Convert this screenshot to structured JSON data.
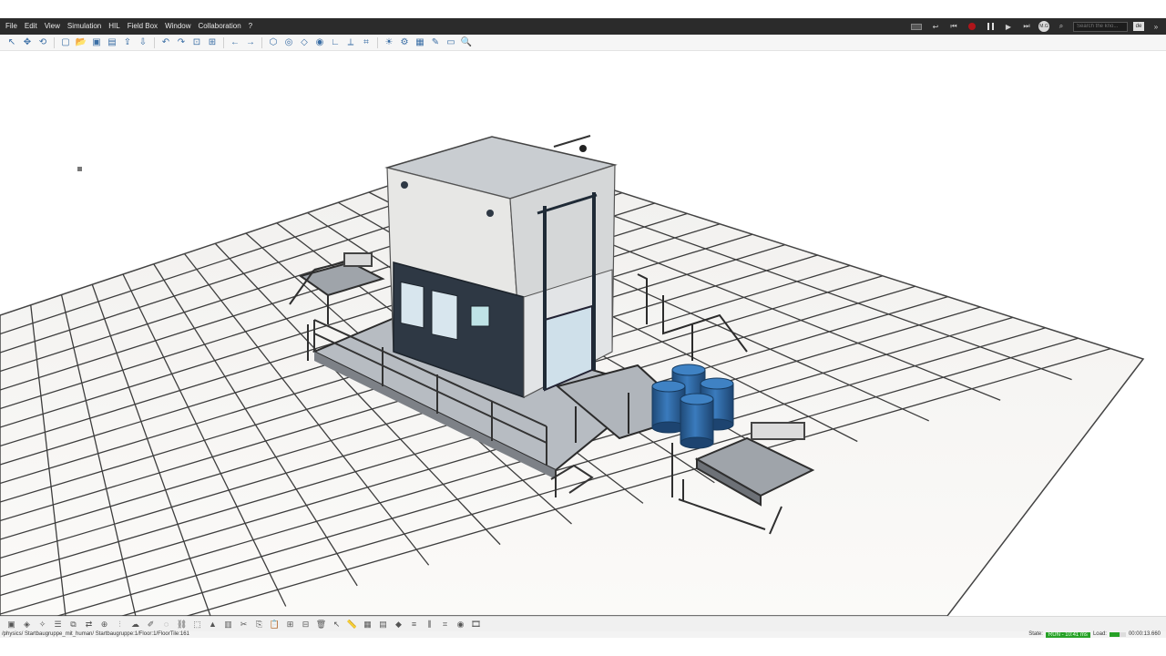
{
  "menubar": {
    "items": [
      "File",
      "Edit",
      "View",
      "Simulation",
      "HIL",
      "Field Box",
      "Window",
      "Collaboration",
      "?"
    ],
    "search_placeholder": "Search the kno...",
    "avatar_initials": "M.G",
    "lang": "de"
  },
  "toolbar": {
    "icons": [
      "select-arrow-icon",
      "move-icon",
      "rotate-icon",
      "new-file-icon",
      "open-folder-icon",
      "save-icon",
      "save-all-icon",
      "export-icon",
      "import-icon",
      "undo-icon",
      "redo-icon",
      "zoom-fit-icon",
      "zoom-select-icon",
      "arrow-left-icon",
      "arrow-right-icon",
      "cube-view-icon",
      "orbit-icon",
      "box-icon",
      "camera-icon",
      "axes-icon",
      "measure-icon",
      "snap-icon",
      "light-icon",
      "gear-icon",
      "grid-icon",
      "brush-icon",
      "window-icon",
      "search-zoom-icon"
    ]
  },
  "viewport": {
    "description_hidden": ""
  },
  "bottom_toolbar": {
    "icons": [
      "frame-icon",
      "component-icon",
      "wrench-icon",
      "list-icon",
      "merge-icon",
      "connect-icon",
      "add-node-icon",
      "split-icon",
      "cloud-icon",
      "pen-icon",
      "lasso-icon",
      "link-icon",
      "box-select-icon",
      "paint-icon",
      "layers-icon",
      "cut-icon",
      "copy-icon",
      "paste-icon",
      "group-icon",
      "ungroup-icon",
      "trash-icon",
      "cursor-icon",
      "ruler-icon",
      "table-icon",
      "chart-icon",
      "shape-icon",
      "align-icon",
      "distribute-icon",
      "snap-grid-icon",
      "camera-icon",
      "film-icon"
    ]
  },
  "statusbar": {
    "path": "/physics/ Startbaugruppe_mit_human/ Startbaugruppe:1/Floor:1/FloorTile:161",
    "state_label": "State:",
    "state_value": "RUN - 10:41 ms",
    "load_label": "Load:",
    "load_percent": 0.62,
    "time": "00:00:13.660"
  },
  "colors": {
    "menubar_bg": "#2b2b2b",
    "accent_blue": "#3a6ea5",
    "status_green": "#27a127",
    "barrel_blue": "#2a5f95"
  }
}
